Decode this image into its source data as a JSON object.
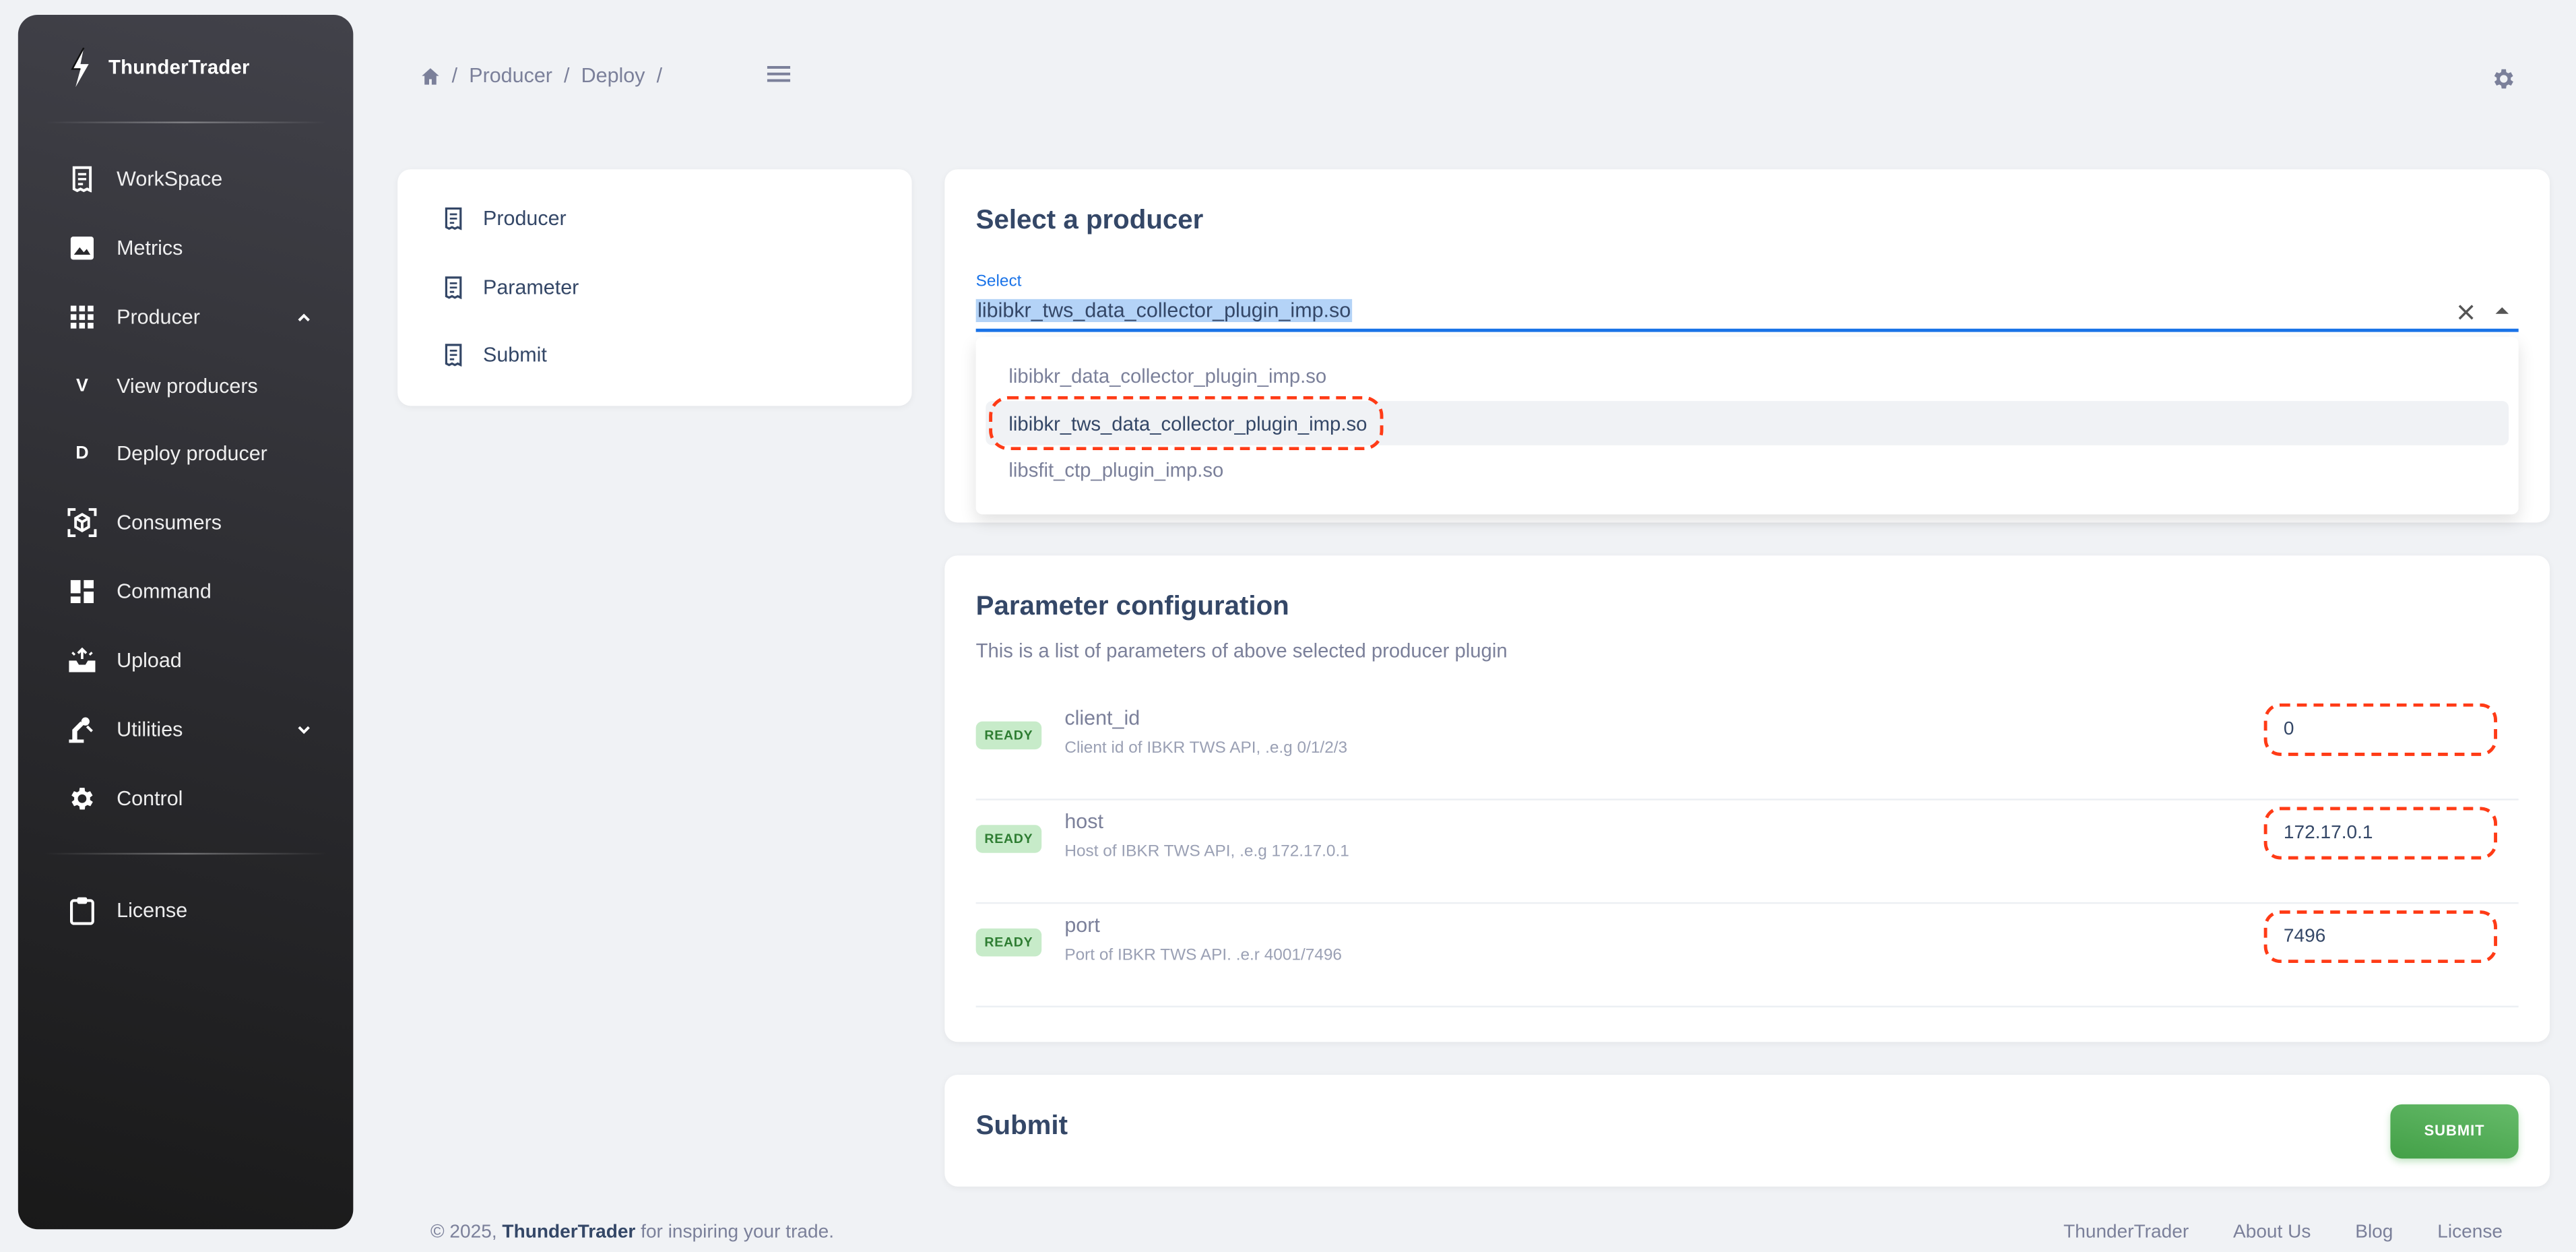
{
  "app": {
    "name": "ThunderTrader"
  },
  "sidebar": {
    "items": [
      {
        "label": "WorkSpace"
      },
      {
        "label": "Metrics"
      },
      {
        "label": "Producer"
      },
      {
        "letter": "V",
        "label": "View producers"
      },
      {
        "letter": "D",
        "label": "Deploy producer"
      },
      {
        "label": "Consumers"
      },
      {
        "label": "Command"
      },
      {
        "label": "Upload"
      },
      {
        "label": "Utilities"
      },
      {
        "label": "Control"
      },
      {
        "label": "License"
      }
    ]
  },
  "breadcrumb": {
    "items": [
      "Producer",
      "Deploy"
    ],
    "separator": "/"
  },
  "steps": [
    "Producer",
    "Parameter",
    "Submit"
  ],
  "select_card": {
    "title": "Select a producer",
    "field_label": "Select",
    "value": "libibkr_tws_data_collector_plugin_imp.so",
    "options": [
      "libibkr_data_collector_plugin_imp.so",
      "libibkr_tws_data_collector_plugin_imp.so",
      "libsfit_ctp_plugin_imp.so"
    ],
    "selected_index": 1
  },
  "param_card": {
    "title": "Parameter configuration",
    "subtitle": "This is a list of parameters of above selected producer plugin",
    "params": [
      {
        "status": "READY",
        "name": "client_id",
        "desc": "Client id of IBKR TWS API, .e.g 0/1/2/3",
        "value": "0"
      },
      {
        "status": "READY",
        "name": "host",
        "desc": "Host of IBKR TWS API, .e.g 172.17.0.1",
        "value": "172.17.0.1"
      },
      {
        "status": "READY",
        "name": "port",
        "desc": "Port of IBKR TWS API. .e.r 4001/7496",
        "value": "7496"
      }
    ]
  },
  "submit_card": {
    "title": "Submit",
    "button": "SUBMIT"
  },
  "footer": {
    "prefix": "© 2025,",
    "brand": "ThunderTrader",
    "suffix": "for inspiring your trade.",
    "links": [
      "ThunderTrader",
      "About Us",
      "Blog",
      "License"
    ]
  },
  "colors": {
    "accent": "#1a73e8",
    "success": "#4caf50",
    "highlight": "#ff3b16",
    "sidebar": "#2a2a2e"
  }
}
